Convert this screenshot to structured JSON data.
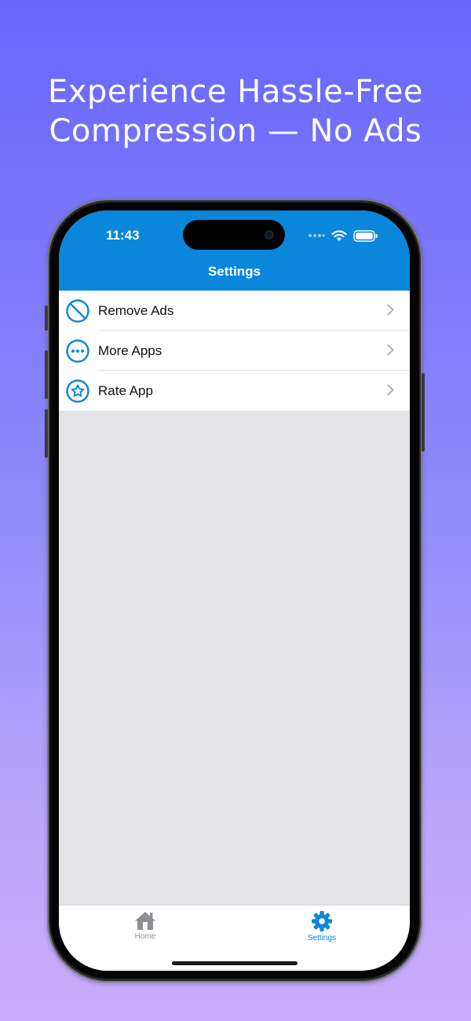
{
  "headline": {
    "line1": "Experience Hassle-Free",
    "line2": "Compression — No Ads"
  },
  "status_bar": {
    "time": "11:43",
    "icons": [
      "signal-dots-icon",
      "wifi-icon",
      "battery-icon"
    ]
  },
  "nav": {
    "title": "Settings"
  },
  "settings_list": {
    "items": [
      {
        "label": "Remove Ads",
        "icon": "no-ads-icon"
      },
      {
        "label": "More Apps",
        "icon": "more-ellipsis-icon"
      },
      {
        "label": "Rate App",
        "icon": "star-icon"
      }
    ]
  },
  "tab_bar": {
    "tabs": [
      {
        "label": "Home",
        "icon": "house-icon",
        "selected": false
      },
      {
        "label": "Settings",
        "icon": "gear-icon",
        "selected": true
      }
    ]
  },
  "colors": {
    "accent": "#0a86db",
    "background_top": "#6766fb",
    "background_bottom": "#c9acfb",
    "list_background": "#e4e3e8"
  }
}
